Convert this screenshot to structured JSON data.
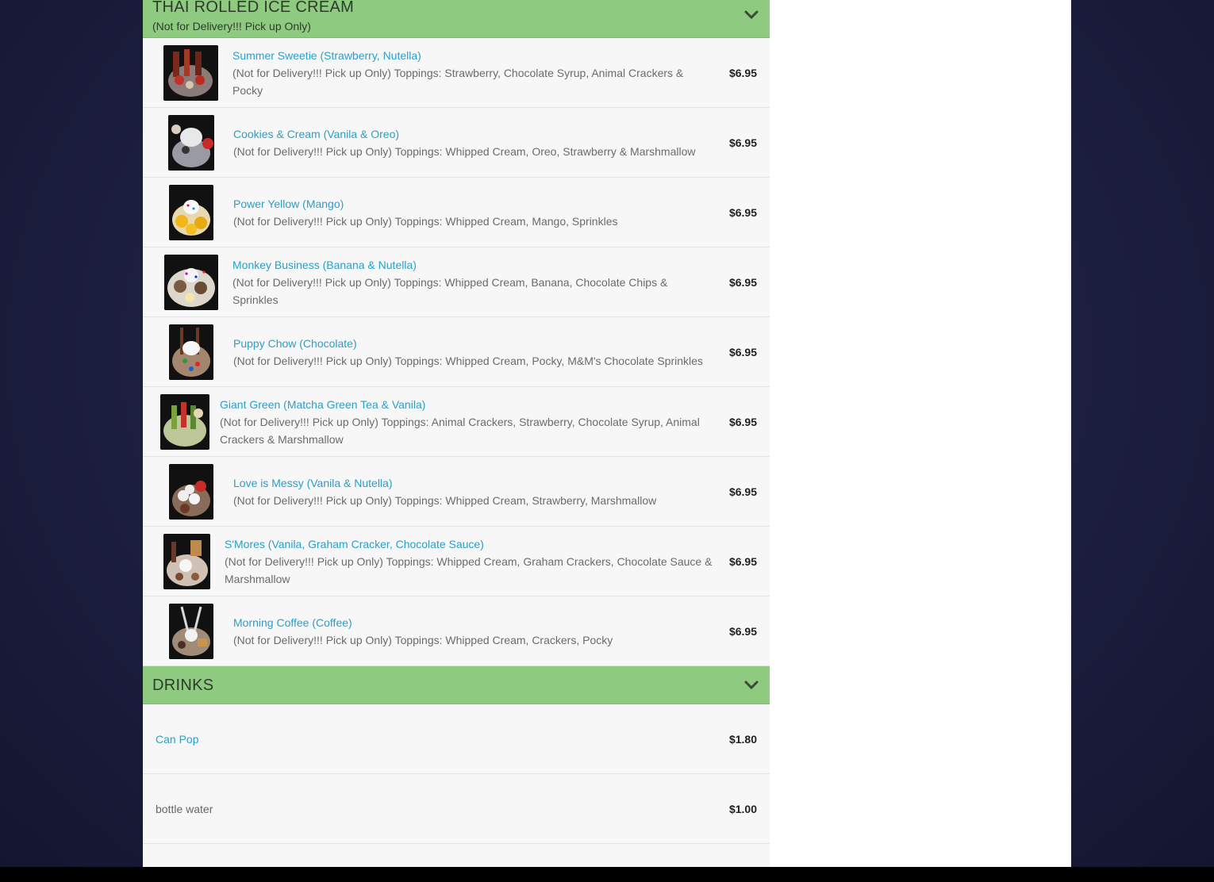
{
  "sections": [
    {
      "title": "THAI ROLLED ICE CREAM",
      "subtitle": "(Not for Delivery!!! Pick up Only)",
      "chevron_icon": "chevron-down-icon",
      "items": [
        {
          "name": "Summer Sweetie (Strawberry, Nutella)",
          "desc": "(Not for Delivery!!! Pick up Only) Toppings: Strawberry, Chocolate Syrup, Animal Crackers & Pocky",
          "price": "$6.95"
        },
        {
          "name": "Cookies & Cream (Vanila & Oreo)",
          "desc": "(Not for Delivery!!! Pick up Only) Toppings: Whipped Cream, Oreo, Strawberry & Marshmallow",
          "price": "$6.95"
        },
        {
          "name": "Power Yellow (Mango)",
          "desc": "(Not for Delivery!!! Pick up Only) Toppings: Whipped Cream, Mango, Sprinkles",
          "price": "$6.95"
        },
        {
          "name": "Monkey Business (Banana & Nutella)",
          "desc": "(Not for Delivery!!! Pick up Only) Toppings: Whipped Cream, Banana, Chocolate Chips & Sprinkles",
          "price": "$6.95"
        },
        {
          "name": "Puppy Chow (Chocolate)",
          "desc": "(Not for Delivery!!! Pick up Only) Toppings: Whipped Cream, Pocky, M&M's Chocolate Sprinkles",
          "price": "$6.95"
        },
        {
          "name": "Giant Green (Matcha Green Tea & Vanila)",
          "desc": "(Not for Delivery!!! Pick up Only) Toppings: Animal Crackers, Strawberry, Chocolate Syrup, Animal Crackers & Marshmallow",
          "price": "$6.95"
        },
        {
          "name": "Love is Messy (Vanila & Nutella)",
          "desc": "(Not for Delivery!!! Pick up Only) Toppings: Whipped Cream, Strawberry, Marshmallow",
          "price": "$6.95"
        },
        {
          "name": "S'Mores (Vanila, Graham Cracker, Chocolate Sauce)",
          "desc": "(Not for Delivery!!! Pick up Only) Toppings: Whipped Cream, Graham Crackers, Chocolate Sauce & Marshmallow",
          "price": "$6.95"
        },
        {
          "name": "Morning Coffee (Coffee)",
          "desc": "(Not for Delivery!!! Pick up Only) Toppings: Whipped Cream, Crackers, Pocky",
          "price": "$6.95"
        }
      ]
    },
    {
      "title": "DRINKS",
      "chevron_icon": "chevron-down-icon",
      "items": [
        {
          "name": "Can Pop",
          "price": "$1.80"
        },
        {
          "name": "bottle water",
          "price": "$1.00"
        }
      ]
    }
  ],
  "colors": {
    "section_header": "#8ecb80",
    "item_link": "#2a9fc9",
    "background_page": "#1f2145"
  }
}
